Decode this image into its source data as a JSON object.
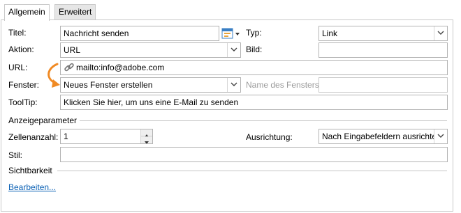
{
  "tabs": [
    "Allgemein",
    "Erweitert"
  ],
  "form": {
    "title_label": "Titel:",
    "title_value": "Nachricht senden",
    "type_label": "Typ:",
    "type_value": "Link",
    "action_label": "Aktion:",
    "action_value": "URL",
    "image_label": "Bild:",
    "image_value": "",
    "url_label": "URL:",
    "url_value": "mailto:info@adobe.com",
    "window_label": "Fenster:",
    "window_value": "Neues Fenster erstellen",
    "window_name_label": "Name des Fensters:",
    "window_name_value": "",
    "tooltip_label": "ToolTip:",
    "tooltip_value": "Klicken Sie hier, um uns eine E-Mail zu senden"
  },
  "display": {
    "section_label": "Anzeigeparameter",
    "cell_count_label": "Zellenanzahl:",
    "cell_count_value": "1",
    "alignment_label": "Ausrichtung:",
    "alignment_value": "Nach Eingabefeldern ausrichten",
    "style_label": "Stil:",
    "style_value": ""
  },
  "visibility": {
    "section_label": "Sichtbarkeit",
    "edit_link": "Bearbeiten..."
  },
  "icons": {
    "title_picker": "calendar-picker-icon",
    "url_link": "chain-link-icon",
    "annotation": "curved-arrow-icon",
    "annotation_color": "#f08a24"
  }
}
